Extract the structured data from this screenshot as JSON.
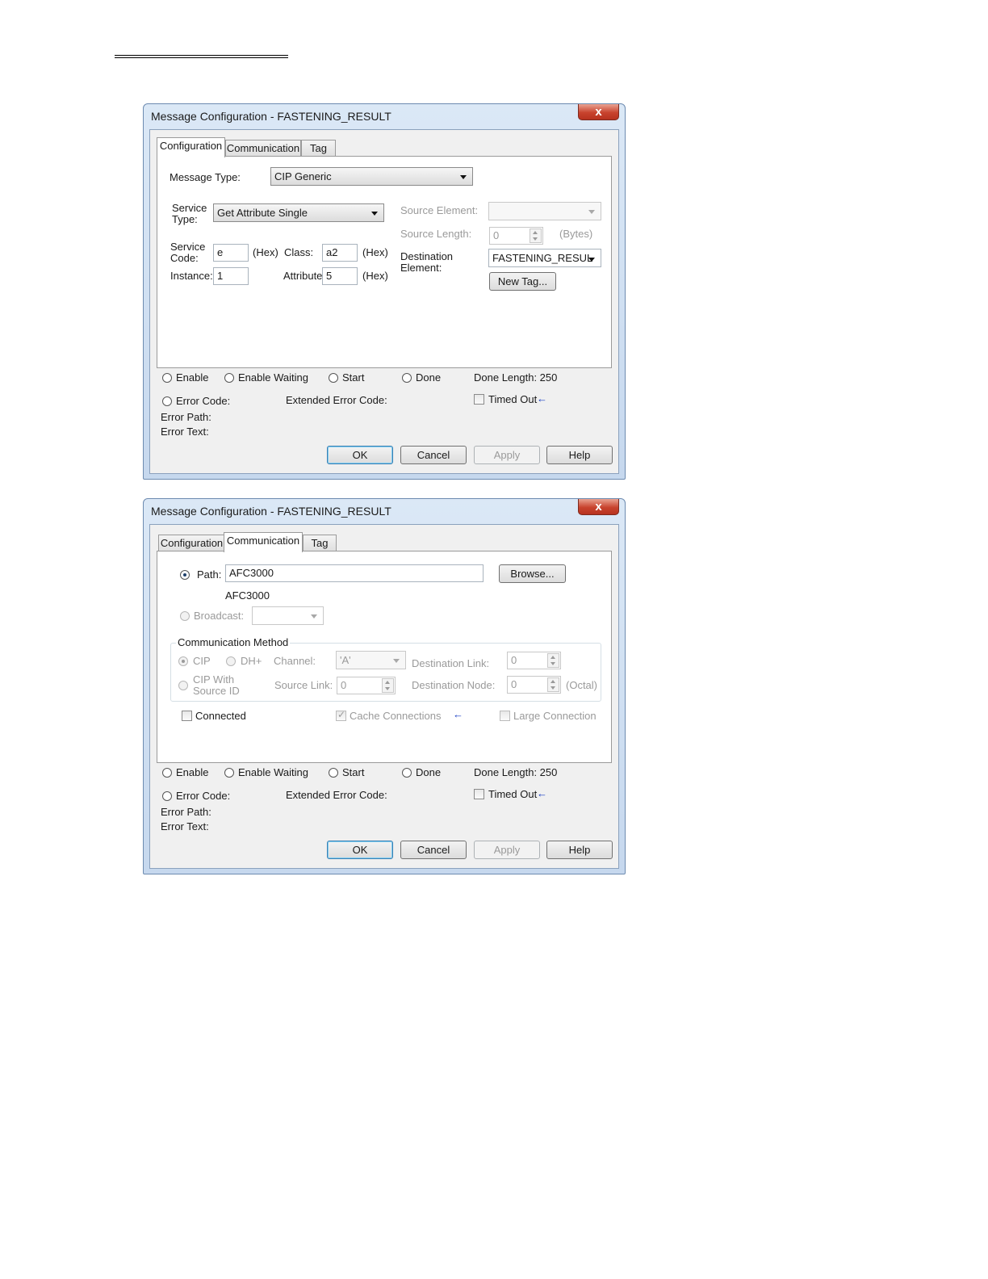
{
  "dialog_title": "Message Configuration - FASTENING_RESULT",
  "close_glyph": "x",
  "tabs": [
    "Configuration",
    "Communication",
    "Tag"
  ],
  "config": {
    "message_type_label": "Message Type:",
    "message_type_value": "CIP Generic",
    "service_type_label1": "Service",
    "service_type_label2": "Type:",
    "service_type_value": "Get Attribute Single",
    "service_code_label1": "Service",
    "service_code_label2": "Code:",
    "service_code_value": "e",
    "hex": "(Hex)",
    "class_label": "Class:",
    "class_value": "a2",
    "instance_label": "Instance:",
    "instance_value": "1",
    "attribute_label": "Attribute:",
    "attribute_value": "5",
    "source_element_label": "Source Element:",
    "source_length_label": "Source Length:",
    "source_length_value": "0",
    "bytes": "(Bytes)",
    "dest_label1": "Destination",
    "dest_label2": "Element:",
    "dest_value": "FASTENING_RESUL",
    "new_tag": "New Tag..."
  },
  "comm": {
    "path_label": "Path:",
    "path_value": "AFC3000",
    "path_resolved": "AFC3000",
    "browse": "Browse...",
    "broadcast_label": "Broadcast:",
    "method_legend": "Communication Method",
    "cip": "CIP",
    "dhplus": "DH+",
    "channel_label": "Channel:",
    "channel_value": "'A'",
    "dest_link_label": "Destination Link:",
    "dest_link_value": "0",
    "cip_with1": "CIP With",
    "cip_with2": "Source ID",
    "source_link_label": "Source Link:",
    "source_link_value": "0",
    "dest_node_label": "Destination Node:",
    "dest_node_value": "0",
    "octal": "(Octal)",
    "connected": "Connected",
    "cache": "Cache Connections",
    "large": "Large Connection"
  },
  "status": {
    "enable": "Enable",
    "enable_waiting": "Enable Waiting",
    "start": "Start",
    "done": "Done",
    "done_length": "Done Length:  250",
    "error_code": "Error Code:",
    "extended_error": "Extended Error Code:",
    "timed_out": "Timed Out",
    "error_path": "Error Path:",
    "error_text": "Error Text:"
  },
  "buttons": {
    "ok": "OK",
    "cancel": "Cancel",
    "apply": "Apply",
    "help": "Help"
  },
  "arrow_glyph": "←"
}
